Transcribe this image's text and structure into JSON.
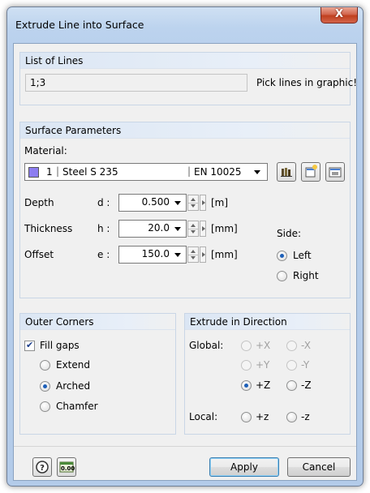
{
  "window": {
    "title": "Extrude Line into Surface",
    "close_label": "X"
  },
  "list_of_lines": {
    "header": "List of Lines",
    "value": "1;3",
    "pick_label": "Pick lines in graphic!"
  },
  "surface_parameters": {
    "header": "Surface Parameters",
    "material_label": "Material:",
    "material": {
      "number": "1",
      "name": "Steel S 235",
      "norm": "EN 10025",
      "swatch_color": "#8c7df0"
    },
    "depth": {
      "label": "Depth",
      "symbol": "d :",
      "value": "0.500",
      "unit": "[m]"
    },
    "thickness": {
      "label": "Thickness",
      "symbol": "h :",
      "value": "20.0",
      "unit": "[mm]"
    },
    "offset": {
      "label": "Offset",
      "symbol": "e :",
      "value": "150.0",
      "unit": "[mm]"
    },
    "side": {
      "label": "Side:",
      "left": "Left",
      "right": "Right",
      "selected": "Left"
    }
  },
  "outer_corners": {
    "header": "Outer Corners",
    "fill_gaps": "Fill gaps",
    "fill_gaps_checked": true,
    "options": [
      "Extend",
      "Arched",
      "Chamfer"
    ],
    "selected": "Arched"
  },
  "extrude_direction": {
    "header": "Extrude in Direction",
    "global_label": "Global:",
    "local_label": "Local:",
    "global_options": [
      "+X",
      "-X",
      "+Y",
      "-Y",
      "+Z",
      "-Z"
    ],
    "local_options": [
      "+z",
      "-z"
    ],
    "selected": "+Z"
  },
  "footer": {
    "apply": "Apply",
    "cancel": "Cancel",
    "units_icon_text": "0.00"
  },
  "icons": [
    "close-icon",
    "library-icon",
    "new-material-icon",
    "edit-material-icon",
    "help-icon",
    "units-icon"
  ]
}
